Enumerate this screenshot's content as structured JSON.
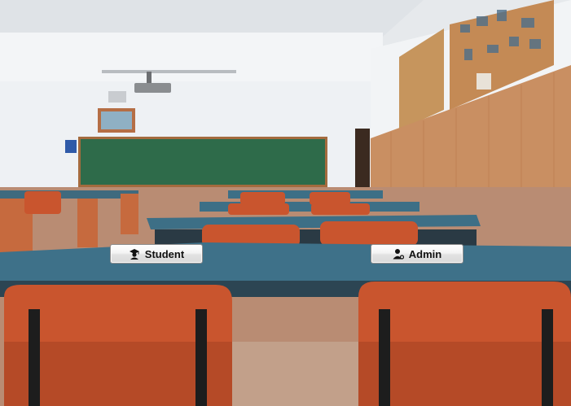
{
  "scene": {
    "background": "classroom-photo",
    "colors": {
      "ceiling": "#e9ecef",
      "wall": "#eef1f4",
      "wood_panel": "#c98f62",
      "corkboard": "#c6955d",
      "chalkboard": "#2e6b4a",
      "desk_top": "#3d6f86",
      "chair": "#c9552e"
    }
  },
  "buttons": {
    "student": {
      "label": "Student",
      "icon": "graduate-icon"
    },
    "admin": {
      "label": "Admin",
      "icon": "admin-user-icon"
    }
  },
  "colors": {
    "button_text": "#111111",
    "button_border": "#8e8e8e"
  }
}
